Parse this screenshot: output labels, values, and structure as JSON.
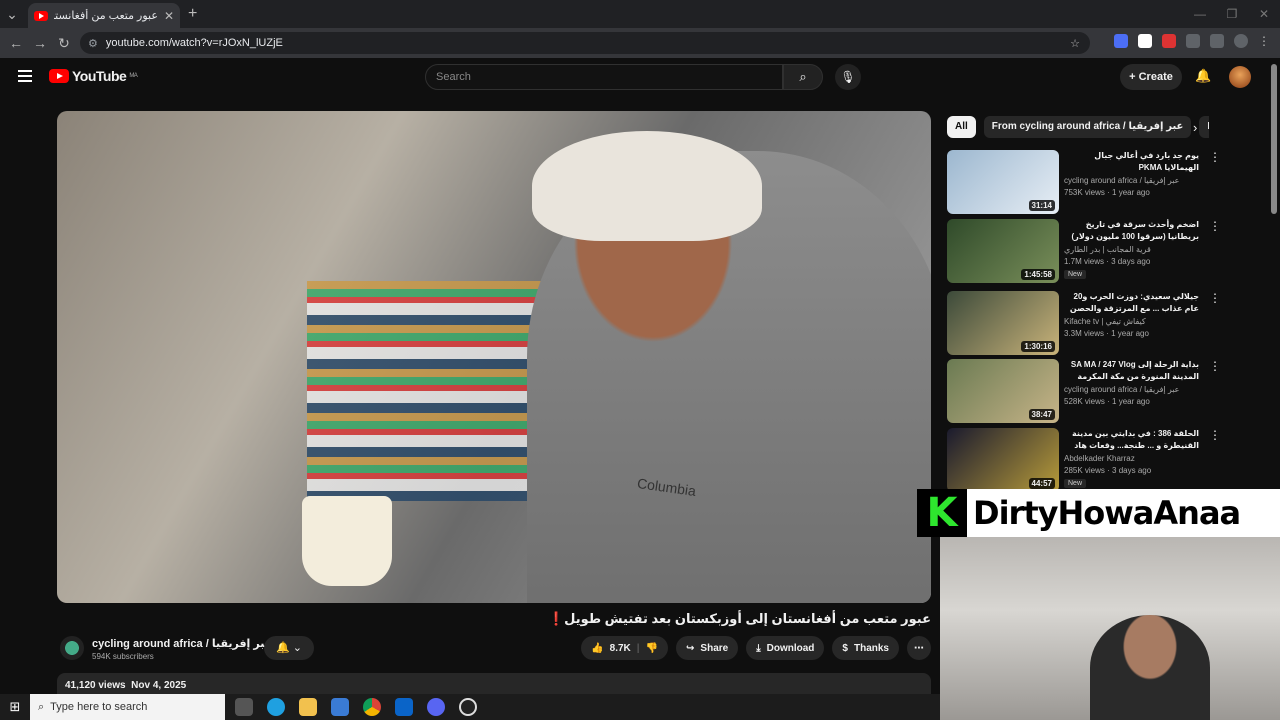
{
  "browser": {
    "tab_title": "عبور متعب من أفغانستان إلى أوز",
    "tab_close": "✕",
    "new_tab": "+",
    "url": "youtube.com/watch?v=rJOxN_lUZjE"
  },
  "header": {
    "logo": "YouTube",
    "logo_region": "MA",
    "search_placeholder": "Search",
    "create_label": "Create"
  },
  "video": {
    "title": "عبور متعب من أفغانستان إلى أوزبكستان بعد تفتيش طويل❗",
    "shirt_brand": "Columbia",
    "channel_name": "cycling around africa / عبر إفريقيا",
    "subscribers": "594K subscribers",
    "likes": "8.7K",
    "share": "Share",
    "download": "Download",
    "thanks": "Thanks",
    "views": "41,120 views",
    "date": "Nov 4, 2025"
  },
  "chips": [
    "All",
    "From cycling around africa / عبر إفريقيا",
    "Relat"
  ],
  "recommendations": [
    {
      "title": "يوم جد بارد في أعالي جبال الهيمالايا PKMA",
      "channel": "cycling around africa / عبر إفريقيا",
      "meta": "753K views · 1 year ago",
      "duration": "31:14",
      "badge": "",
      "color1": "#9cb7cf",
      "color2": "#e7eef5"
    },
    {
      "title": "اضخم وأحدث سرقة في تاريخ بريطانيا (سرقوا 100 مليون دولار)",
      "channel": "قرية المجانب | بدر الطاري",
      "meta": "1.7M views · 3 days ago",
      "duration": "1:45:58",
      "badge": "New",
      "color1": "#2f4a2a",
      "color2": "#7a8f5a"
    },
    {
      "title": "جيلالي سعيدي: دوزت الحرب و20 عام عذاب ... مع المرتزقة والحصن اللي زارنا مع وراي",
      "channel": "Kifache tv | كيفاش تيفي",
      "meta": "3.3M views · 1 year ago",
      "duration": "1:30:16",
      "badge": "",
      "color1": "#3c4a3a",
      "color2": "#c9b37a"
    },
    {
      "title": "بداية الرحلة إلى SA MA / 247 Vlog المدينة المنورة من مكة المكرمة",
      "channel": "cycling around africa / عبر إفريقيا",
      "meta": "528K views · 1 year ago",
      "duration": "38:47",
      "badge": "",
      "color1": "#6a7a52",
      "color2": "#c7b488"
    },
    {
      "title": "الحلقة 386 : في بدايتي بين مدينة القنيطرة و ... طنجة... وقعات هاد القصة الغريبة... خراز",
      "channel": "Abdelkader Kharraz",
      "meta": "285K views · 3 days ago",
      "duration": "44:57",
      "badge": "New",
      "color1": "#1a1a2e",
      "color2": "#b89c3a"
    }
  ],
  "overlay": {
    "logo_letter": "K",
    "text": "DirtyHowaAnaa"
  },
  "taskbar": {
    "search_placeholder": "Type here to search"
  }
}
